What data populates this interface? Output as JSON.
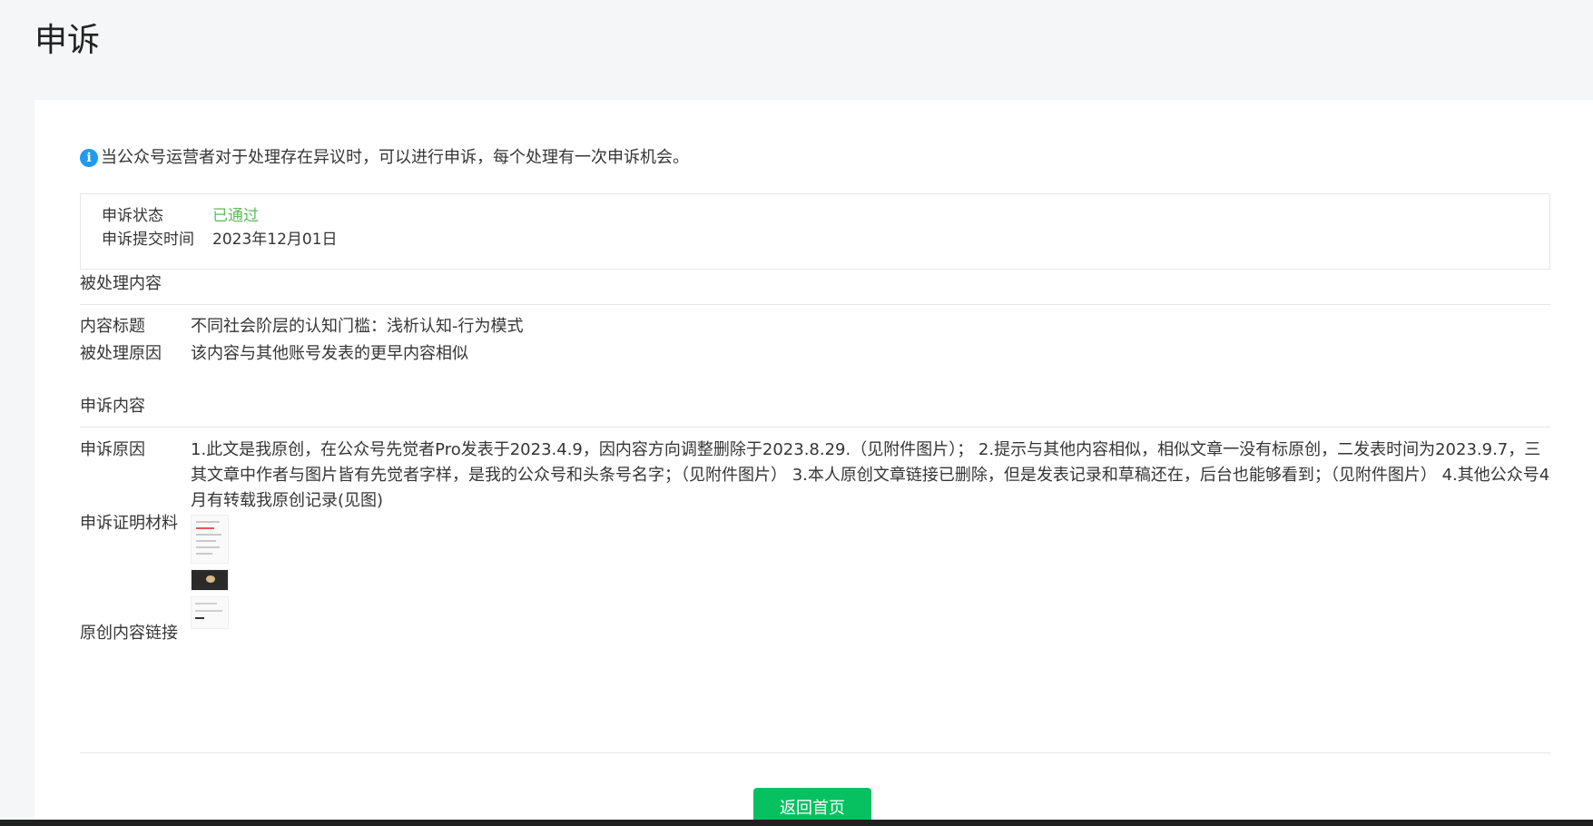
{
  "page": {
    "title": "申诉"
  },
  "notice": {
    "icon": "info-icon",
    "text": "当公众号运营者对于处理存在异议时，可以进行申诉，每个处理有一次申诉机会。"
  },
  "status": {
    "status_label": "申诉状态",
    "status_value": "已通过",
    "status_color": "#5dbb58",
    "time_label": "申诉提交时间",
    "time_value": "2023年12月01日"
  },
  "processed": {
    "section_title": "被处理内容",
    "title_label": "内容标题",
    "title_value": "不同社会阶层的认知门槛：浅析认知-行为模式",
    "reason_label": "被处理原因",
    "reason_value": "该内容与其他账号发表的更早内容相似"
  },
  "appeal": {
    "section_title": "申诉内容",
    "reason_label": "申诉原因",
    "reason_value": "1.此文是我原创，在公众号先觉者Pro发表于2023.4.9，因内容方向调整删除于2023.8.29.（见附件图片）； 2.提示与其他内容相似，相似文章一没有标原创，二发表时间为2023.9.7，三其文章中作者与图片皆有先觉者字样，是我的公众号和头条号名字；（见附件图片） 3.本人原创文章链接已删除，但是发表记录和草稿还在，后台也能够看到；（见附件图片） 4.其他公众号4月有转载我原创记录(见图)",
    "evidence_label": "申诉证明材料",
    "link_label": "原创内容链接"
  },
  "actions": {
    "back_label": "返回首页",
    "accent_color": "#07c160"
  }
}
